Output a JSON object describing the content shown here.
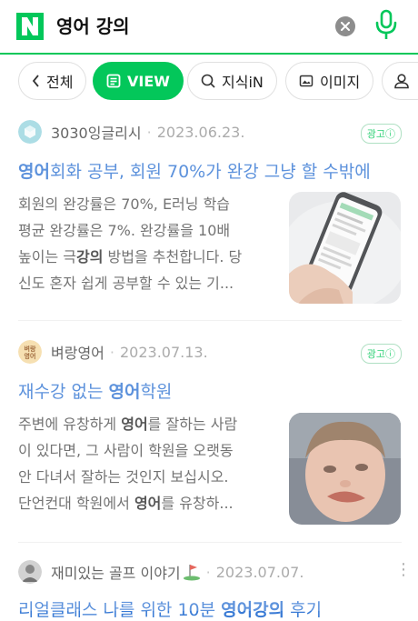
{
  "search": {
    "query": "영어 강의"
  },
  "tabs": [
    {
      "label": "전체"
    },
    {
      "label": "VIEW"
    },
    {
      "label": "지식iN"
    },
    {
      "label": "이미지"
    }
  ],
  "results": [
    {
      "author": "3030잉글리시",
      "date": "2023.06.23.",
      "ad_label": "광고ⓘ",
      "title_bold": "영어",
      "title_rest": "회화 공부, 회원 70%가 완강 그냥 할 수밖에",
      "desc_lines": [
        "회원의 완강률은 70%, E러닝 학습",
        "평균 완강률은 7%. 완강률을 10배"
      ],
      "desc_line3_pre": "높이는 극",
      "desc_line3_bold": "강의",
      "desc_line3_post": " 방법을 추천합니다. 당",
      "desc_line4": "신도 혼자 쉽게 공부할 수 있는 기..."
    },
    {
      "author": "벼랑영어",
      "avatar_text": "벼랑\n영어",
      "date": "2023.07.13.",
      "ad_label": "광고ⓘ",
      "title_pre": "재수강 없는 ",
      "title_bold": "영어",
      "title_post": "학원",
      "desc_line1_pre": "주변에 유창하게 ",
      "desc_line1_bold": "영어",
      "desc_line1_post": "를 잘하는 사람",
      "desc_line2": "이 있다면, 그 사람이 학원을 오랫동",
      "desc_line3": "안 다녀서 잘하는 것인지 보십시오.",
      "desc_line4_pre": "단언컨대 학원에서 ",
      "desc_line4_bold": "영어",
      "desc_line4_post": "를 유창하..."
    },
    {
      "author": "재미있는 골프 이야기",
      "date": "2023.07.07.",
      "title_pre": "리얼클래스 나를 위한 10분 ",
      "title_bold": "영어강의",
      "title_post": " 후기"
    }
  ],
  "colors": {
    "brand": "#03c75a",
    "link": "#3a7bd5"
  }
}
